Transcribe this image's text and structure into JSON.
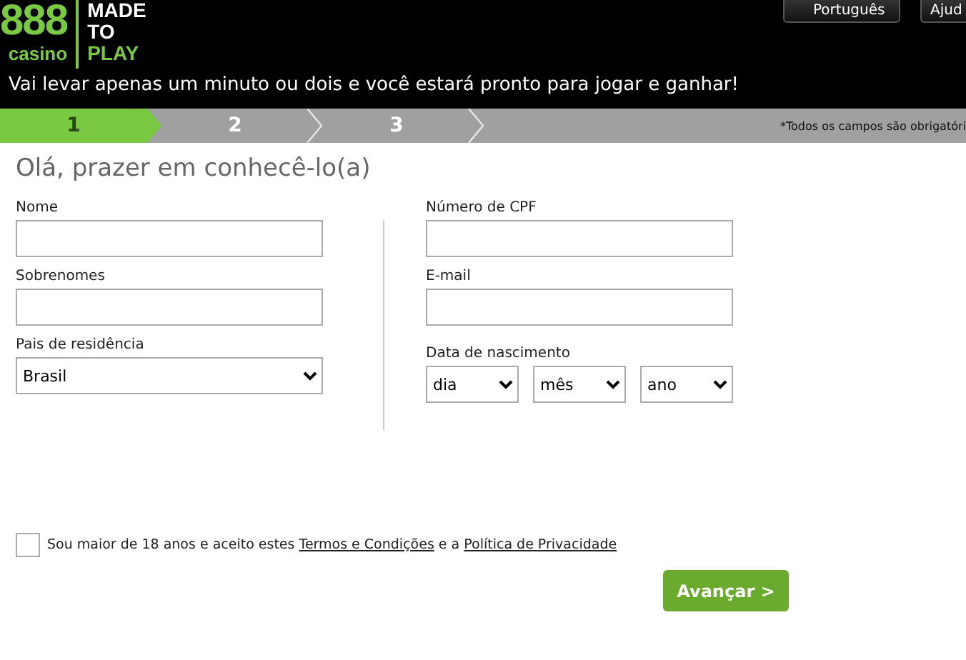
{
  "header": {
    "logo": {
      "number": "888",
      "sub": "casino",
      "slogan": [
        "MADE",
        "TO",
        "PLAY"
      ]
    },
    "buttons": [
      {
        "label": "Português",
        "kind": "language"
      },
      {
        "label": "Ajud",
        "kind": "plain"
      }
    ],
    "tagline": "Vai levar apenas um minuto ou dois e você estará pronto para jogar e ganhar!"
  },
  "steps": [
    {
      "label": "1",
      "selected": true
    },
    {
      "label": "2",
      "selected": false
    },
    {
      "label": "3",
      "selected": false
    }
  ],
  "required_note": "*Todos os campos são obrigatóri",
  "title": "Olá, prazer em conhecê-lo(a)",
  "left_fields": [
    {
      "label": "Nome",
      "kind": "text"
    },
    {
      "label": "Sobrenomes",
      "kind": "text"
    },
    {
      "label": "Pais de residência",
      "kind": "select",
      "value": "Brasil"
    }
  ],
  "right_fields": [
    {
      "label": "Número de CPF",
      "kind": "text"
    },
    {
      "label": "E-mail",
      "kind": "text"
    }
  ],
  "birth": {
    "label": "Data de nascimento",
    "selects": [
      "dia",
      "mês",
      "ano"
    ]
  },
  "consent": {
    "checked": false,
    "before": "Sou maior de 18 anos e aceito estes",
    "link1": "Termos e Condições",
    "middle": "e a",
    "link2": "Política de Privacidade"
  },
  "submit": "Avançar >"
}
